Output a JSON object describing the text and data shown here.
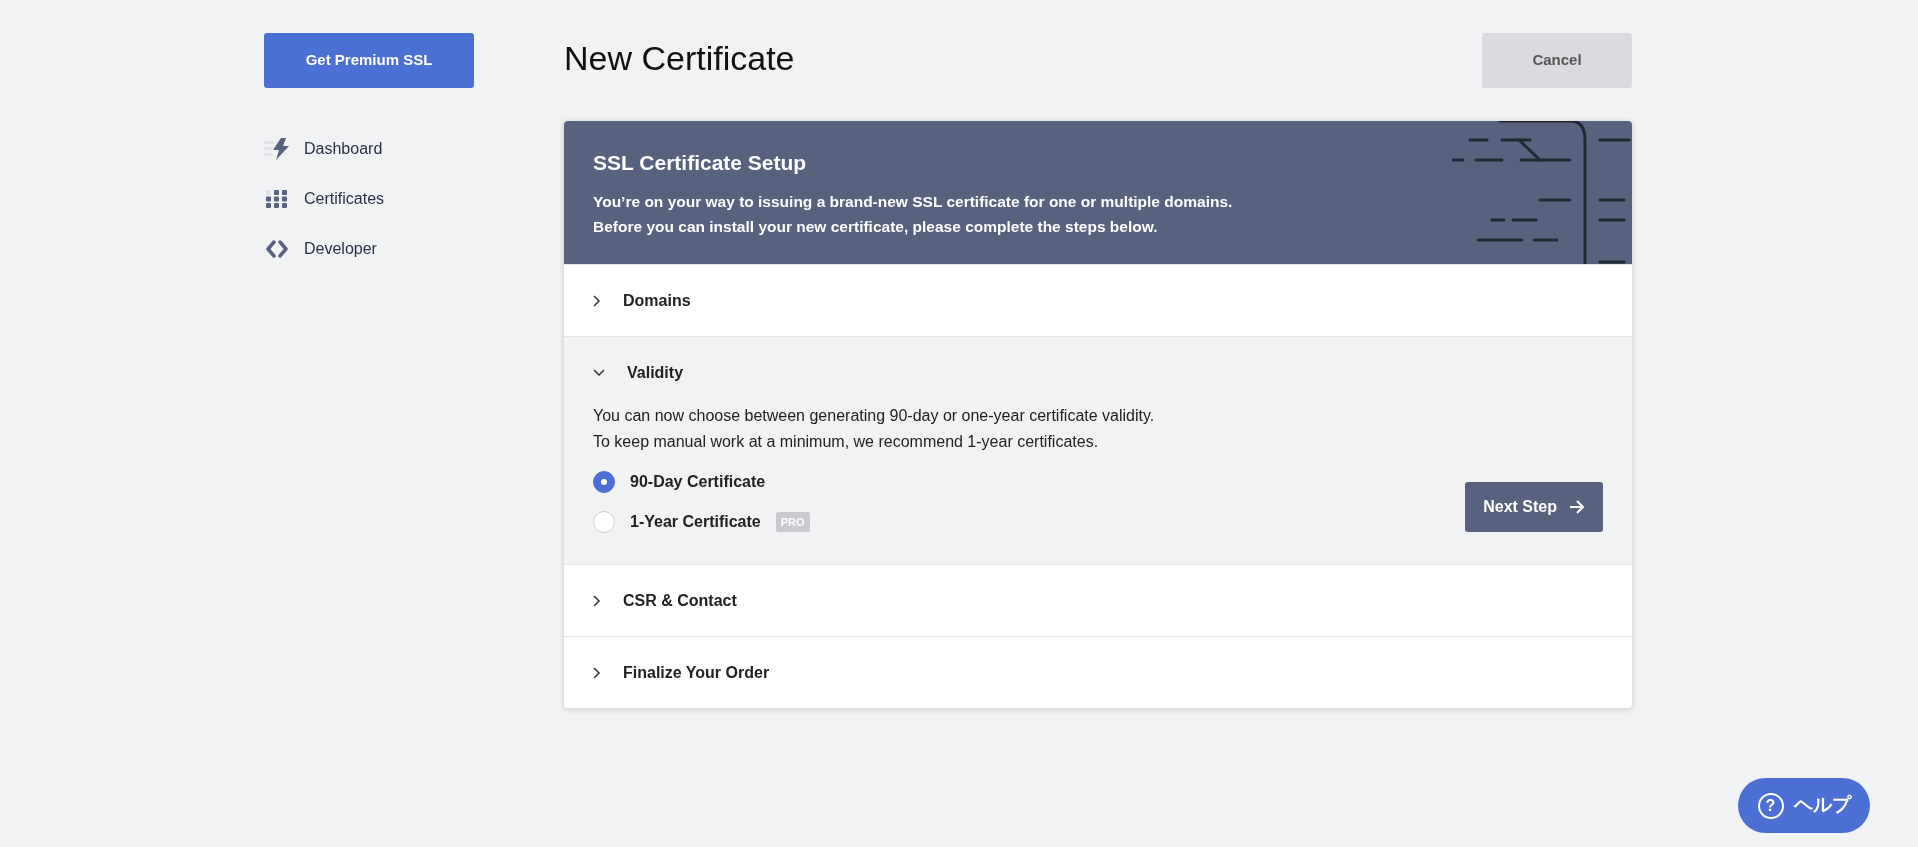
{
  "sidebar": {
    "cta": "Get Premium SSL",
    "items": [
      {
        "label": "Dashboard",
        "selected": false
      },
      {
        "label": "Certificates",
        "selected": false
      },
      {
        "label": "Developer",
        "selected": false
      }
    ]
  },
  "header": {
    "title": "New Certificate",
    "cancel": "Cancel"
  },
  "banner": {
    "title": "SSL Certificate Setup",
    "lines": [
      "You’re on your way to issuing a brand-new SSL certificate for one or multiple domains.",
      "Before you can install your new certificate, please complete the steps below."
    ]
  },
  "steps": [
    {
      "title": "Domains",
      "expanded": false
    },
    {
      "title": "Validity",
      "expanded": true,
      "description": [
        "You can now choose between generating 90-day or one-year certificate validity.",
        "To keep manual work at a minimum, we recommend 1-year certificates."
      ],
      "options": [
        {
          "label": "90-Day Certificate",
          "selected": true
        },
        {
          "label": "1-Year Certificate",
          "selected": false,
          "badge": "PRO"
        }
      ],
      "next": "Next Step"
    },
    {
      "title": "CSR & Contact",
      "expanded": false
    },
    {
      "title": "Finalize Your Order",
      "expanded": false
    }
  ],
  "help": {
    "icon": "?",
    "label": "ヘルプ"
  }
}
